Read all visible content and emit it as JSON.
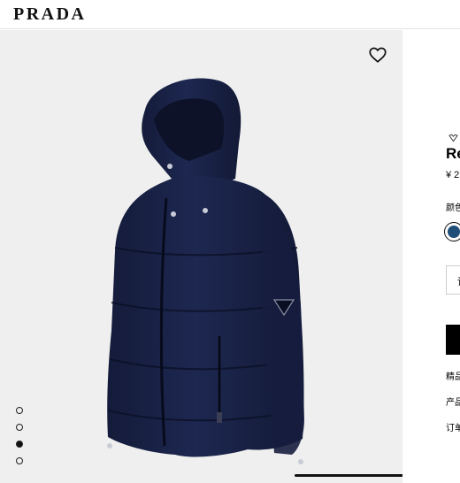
{
  "header": {
    "logo": "PRADA"
  },
  "gallery": {
    "image_alt": "navy hooded puffer down jacket",
    "dots": [
      {
        "active": false
      },
      {
        "active": false
      },
      {
        "active": true
      },
      {
        "active": false
      }
    ],
    "icons": {
      "wishlist": "heart-icon"
    }
  },
  "product": {
    "tag": "",
    "name": "Re",
    "price": "¥ 2",
    "color_label": "颜色",
    "color_swatch": "#1f4e79",
    "size_button_label": "请",
    "info_links": [
      "精品",
      "产品",
      "订单"
    ]
  },
  "colors": {
    "jacket_base": "#1a2347",
    "background": "#efefef",
    "accent": "#000000"
  }
}
